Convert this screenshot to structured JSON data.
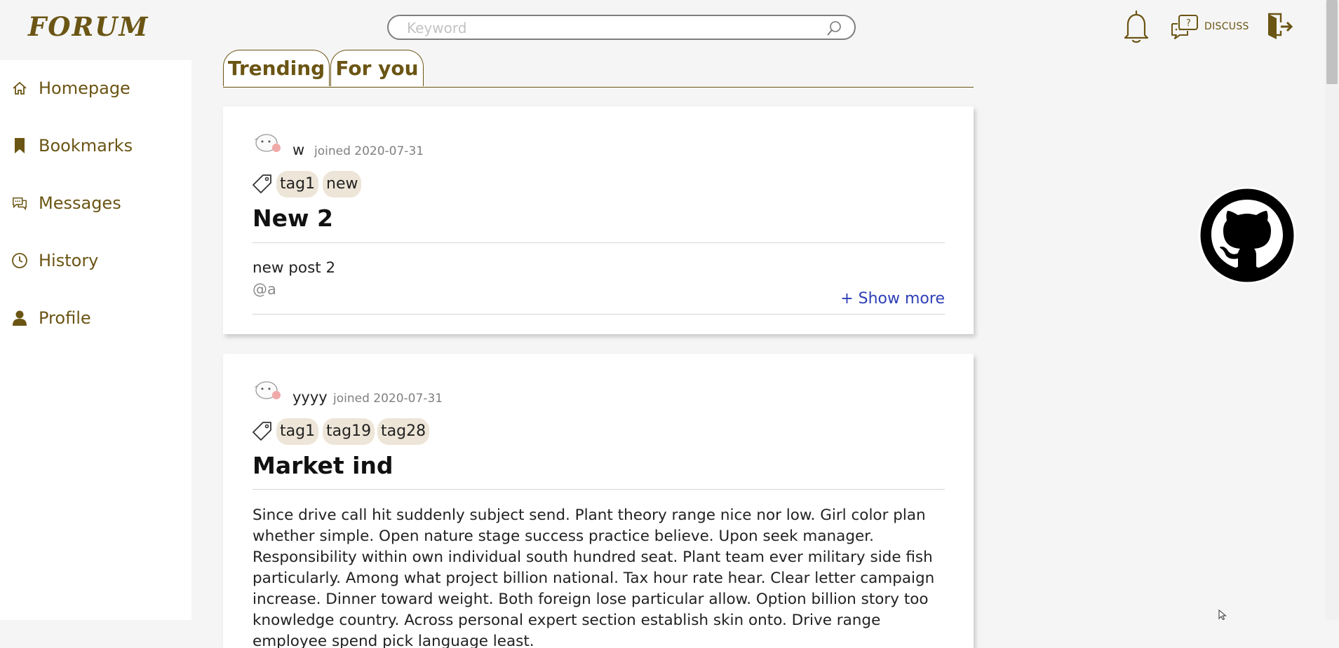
{
  "app": {
    "logo": "FORUM"
  },
  "search": {
    "placeholder": "Keyword",
    "value": ""
  },
  "header": {
    "discuss_label": "DISCUSS"
  },
  "sidebar": {
    "items": [
      {
        "label": "Homepage",
        "icon": "home-icon"
      },
      {
        "label": "Bookmarks",
        "icon": "bookmark-icon"
      },
      {
        "label": "Messages",
        "icon": "chat-icon"
      },
      {
        "label": "History",
        "icon": "clock-icon"
      },
      {
        "label": "Profile",
        "icon": "user-icon"
      }
    ]
  },
  "tabs": [
    {
      "label": "Trending",
      "active": true
    },
    {
      "label": "For you",
      "active": false
    }
  ],
  "posts": [
    {
      "username": "w",
      "joined": "joined 2020-07-31",
      "tags": [
        "tag1",
        "new"
      ],
      "title": "New 2",
      "body": "new post 2",
      "mention": "@a",
      "show_more": "+ Show more"
    },
    {
      "username": "yyyy",
      "joined": "joined 2020-07-31",
      "tags": [
        "tag1",
        "tag19",
        "tag28"
      ],
      "title": "Market ind",
      "body": "Since drive call hit suddenly subject send. Plant theory range nice nor low. Girl color plan whether simple. Open nature stage success practice believe. Upon seek manager. Responsibility within own individual south hundred seat. Plant team ever military side fish particularly. Among what project billion national. Tax hour rate hear. Clear letter campaign increase. Dinner toward weight. Both foreign lose particular allow. Option billion story too knowledge country. Across personal expert section establish skin onto. Drive range employee spend pick language least."
    }
  ],
  "colors": {
    "brand": "#6b5514",
    "link": "#2d3fb5",
    "tag_bg": "#ede5d7"
  }
}
